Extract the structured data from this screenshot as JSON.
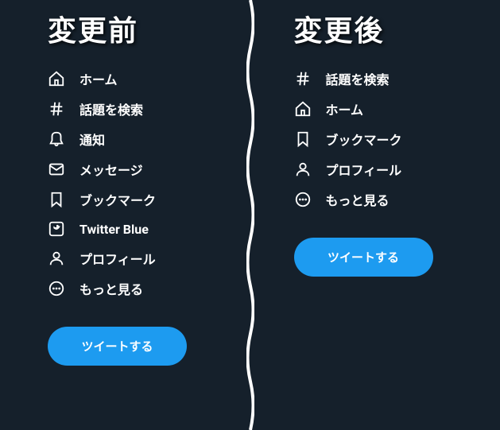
{
  "before": {
    "title": "変更前",
    "items": [
      {
        "icon": "home",
        "label": "ホーム"
      },
      {
        "icon": "hash",
        "label": "話題を検索"
      },
      {
        "icon": "bell",
        "label": "通知"
      },
      {
        "icon": "mail",
        "label": "メッセージ"
      },
      {
        "icon": "bookmark",
        "label": "ブックマーク"
      },
      {
        "icon": "twitter-blue",
        "label": "Twitter Blue"
      },
      {
        "icon": "profile",
        "label": "プロフィール"
      },
      {
        "icon": "more",
        "label": "もっと見る"
      }
    ],
    "tweet_button": "ツイートする"
  },
  "after": {
    "title": "変更後",
    "items": [
      {
        "icon": "hash",
        "label": "話題を検索"
      },
      {
        "icon": "home",
        "label": "ホーム"
      },
      {
        "icon": "bookmark",
        "label": "ブックマーク"
      },
      {
        "icon": "profile",
        "label": "プロフィール"
      },
      {
        "icon": "more",
        "label": "もっと見る"
      }
    ],
    "tweet_button": "ツイートする"
  }
}
